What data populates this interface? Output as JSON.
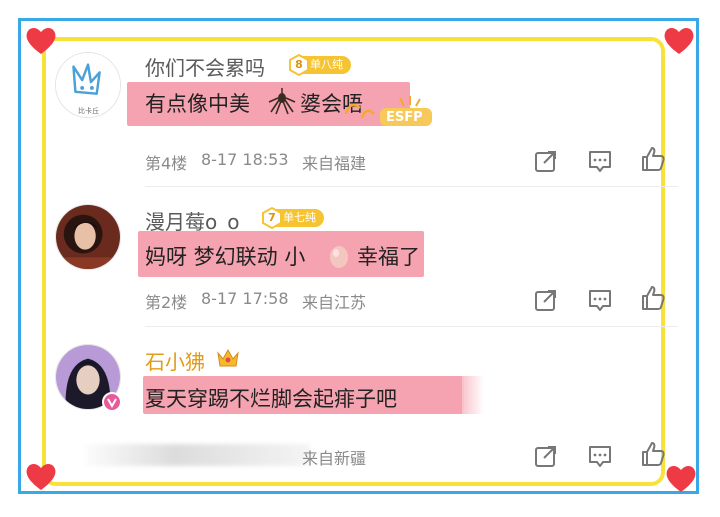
{
  "colors": {
    "outer_border": "#38a8e6",
    "inner_border": "#f8e23a",
    "heart": "#ee3a45",
    "highlight": "#f5a3b0",
    "badge": "#f6c433",
    "vip_name": "#e39a1a"
  },
  "comments": [
    {
      "username": "你们不会累吗",
      "level": "8",
      "badge_label": "单八纯",
      "avatar_caption": "比卡丘",
      "text_before": "有点像中美",
      "text_after": "婆会唔",
      "floor": "第4楼",
      "datetime": "8-17 18:53",
      "location": "来自福建",
      "sticker_text": "ESFP"
    },
    {
      "username": "漫月莓o_o",
      "level": "7",
      "badge_label": "单七纯",
      "text_before": "妈呀 梦幻联动 小",
      "text_after": "幸福了",
      "floor": "第2楼",
      "datetime": "8-17 17:58",
      "location": "来自江苏"
    },
    {
      "username": "石小狒",
      "text": "夏天穿踢不烂脚会起痱子吧",
      "location_partial": "来自新疆"
    }
  ],
  "icons": [
    "heart-icon",
    "share-icon",
    "comment-icon",
    "like-icon",
    "crown-icon",
    "verified-icon"
  ]
}
